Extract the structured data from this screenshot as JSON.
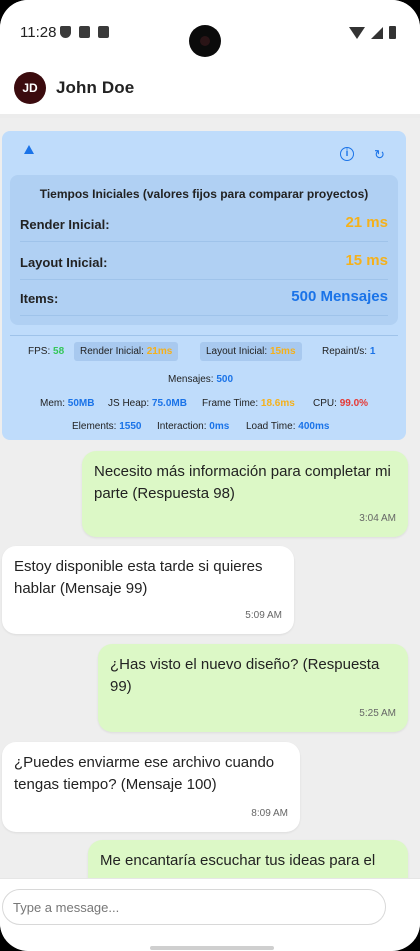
{
  "status_bar": {
    "time": "11:28"
  },
  "contact": {
    "initials": "JD",
    "name": "John Doe"
  },
  "perf_panel": {
    "collapse_icon": "triangle-up-icon",
    "info_icon": "info-icon",
    "refresh_icon": "refresh-icon",
    "initial_title": "Tiempos Iniciales (valores fijos para comparar proyectos)",
    "rows": [
      {
        "label": "Render Inicial:",
        "value": "21 ms"
      },
      {
        "label": "Layout Inicial:",
        "value": "15 ms"
      },
      {
        "label": "Items:",
        "value": "500 Mensajes"
      }
    ],
    "fps_label": "FPS:",
    "fps_value": "58",
    "render_label": "Render Inicial:",
    "render_value": "21ms",
    "layout_label": "Layout Inicial:",
    "layout_value": "15ms",
    "repaint_label": "Repaint/s:",
    "repaint_value": "1",
    "mensajes_label": "Mensajes:",
    "mensajes_value": "500",
    "mem_label": "Mem:",
    "mem_value": "50MB",
    "heap_label": "JS Heap:",
    "heap_value": "75.0MB",
    "frame_label": "Frame Time:",
    "frame_value": "18.6ms",
    "cpu_label": "CPU:",
    "cpu_value": "99.0%",
    "elements_label": "Elements:",
    "elements_value": "1550",
    "interaction_label": "Interaction:",
    "interaction_value": "0ms",
    "load_label": "Load Time:",
    "load_value": "400ms"
  },
  "messages": [
    {
      "text": "Necesito más información para completar mi parte (Respuesta 98)",
      "time": "3:04 AM"
    },
    {
      "text": "Estoy disponible esta tarde si quieres hablar (Mensaje 99)",
      "time": "5:09 AM"
    },
    {
      "text": "¿Has visto el nuevo diseño? (Respuesta 99)",
      "time": "5:25 AM"
    },
    {
      "text": "¿Puedes enviarme ese archivo cuando tengas tiempo? (Mensaje 100)",
      "time": "8:09 AM"
    },
    {
      "text": "Me encantaría escuchar tus ideas para el",
      "time": ""
    }
  ],
  "composer": {
    "placeholder": "Type a message..."
  },
  "colors": {
    "sent_bubble": "#dcf8c6",
    "received_bubble": "#ffffff",
    "panel_bg": "#bfdcfb",
    "accent": "#1a73e8"
  }
}
